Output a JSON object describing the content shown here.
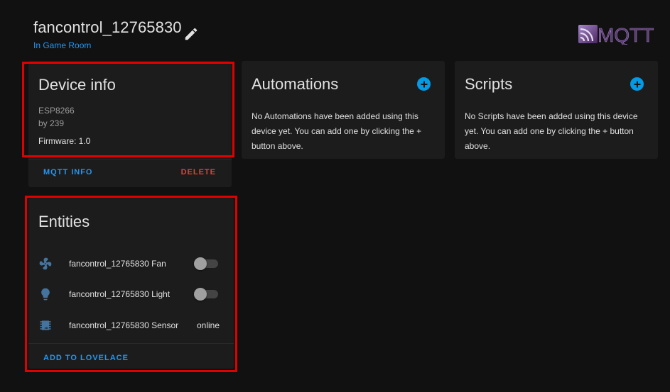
{
  "header": {
    "device_name": "fancontrol_12765830",
    "area": "In Game Room",
    "logo_text": "MQTT"
  },
  "device_info": {
    "title": "Device info",
    "model": "ESP8266",
    "manufacturer": "by 239",
    "firmware": "Firmware: 1.0",
    "mqtt_info_label": "MQTT INFO",
    "delete_label": "DELETE"
  },
  "automations": {
    "title": "Automations",
    "empty_text": "No Automations have been added using this device yet. You can add one by clicking the + button above."
  },
  "scripts": {
    "title": "Scripts",
    "empty_text": "No Scripts have been added using this device yet. You can add one by clicking the + button above."
  },
  "entities": {
    "title": "Entities",
    "items": [
      {
        "icon": "fan-icon",
        "name": "fancontrol_12765830 Fan",
        "control": "toggle",
        "on": false
      },
      {
        "icon": "lightbulb-icon",
        "name": "fancontrol_12765830 Light",
        "control": "toggle",
        "on": false
      },
      {
        "icon": "chip-icon",
        "name": "fancontrol_12765830 Sensor",
        "state": "online"
      }
    ],
    "add_to_lovelace_label": "ADD TO LOVELACE"
  },
  "colors": {
    "background": "#111111",
    "card": "#1c1c1c",
    "accent": "#2196f3",
    "delete": "#db4437",
    "icon": "#44739e",
    "highlight": "#e00000"
  }
}
